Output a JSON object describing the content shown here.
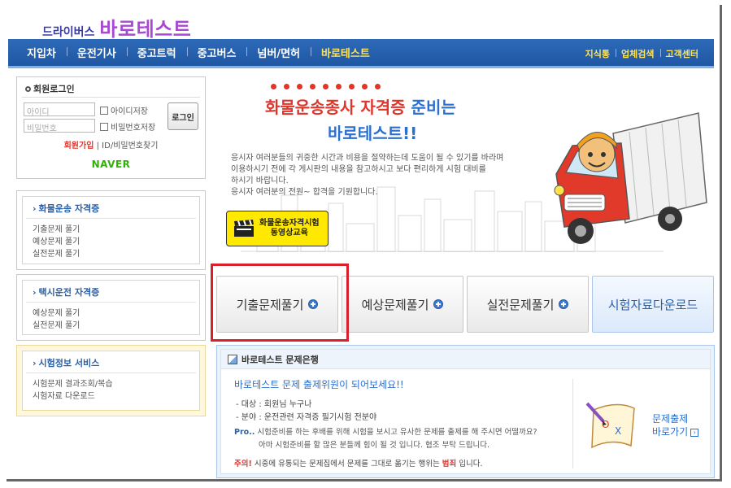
{
  "header": {
    "logo_small": "드라이버스",
    "logo_big": "바로테스트"
  },
  "nav": {
    "items": [
      "지입차",
      "운전기사",
      "중고트럭",
      "중고버스",
      "넘버/면허",
      "바로테스트"
    ],
    "right_items": [
      "지식통",
      "업체검색",
      "고객센터"
    ]
  },
  "login": {
    "title": "회원로그인",
    "id_placeholder": "아이디",
    "pw_placeholder": "비밀번호",
    "save_id": "아이디저장",
    "save_pw": "비밀번호저장",
    "login_button": "로그인",
    "join": "회원가입",
    "find": "ID/비밀번호찾기",
    "naver": "NAVER"
  },
  "sidebar": {
    "truck": {
      "title": "화물운송 자격증",
      "items": [
        "기출문제 풀기",
        "예상문제 풀기",
        "실전문제 풀기"
      ]
    },
    "taxi": {
      "title": "택시운전 자격증",
      "items": [
        "예상문제 풀기",
        "실전문제 풀기"
      ]
    },
    "info": {
      "title": "시험정보 서비스",
      "items": [
        "시험문제 결과조회/복습",
        "시험자료 다운로드"
      ]
    }
  },
  "hero": {
    "title1_red": "화물운송종사 자격증",
    "title1_blue": " 준비는",
    "title2": "바로테스트!!",
    "desc": [
      "응시자 여러분들의 귀중한 시간과 비용을 절약하는데 도움이 될 수 있기를 바라며",
      "이용하시기  전에 각 게시판의 내용을 참고하시고 보다 편리하게 시험 대비를",
      "하시기 바랍니다.",
      "응시자 여러분의 전원~ 합격을 기원합니다."
    ],
    "video_line1": "화물운송자격시험",
    "video_line2": "동영상교육"
  },
  "tabs": {
    "past": "기출문제풀기",
    "expected": "예상문제풀기",
    "practice": "실전문제풀기",
    "download": "시험자료다운로드"
  },
  "qbank": {
    "header": "바로테스트 문제은행",
    "title": "바로테스트 문제 출제위원이 되어보세요!!",
    "target": "- 대상 : 회원님 누구나",
    "field": "- 분야 : 운전관련 자격증 필기시험 전분야",
    "pro_label": "Pro..",
    "pro_text1": " 시험준비를 하는 후배를 위해 시험을 보시고 유사한 문제를 출제를 해 주시면 어떨까요?",
    "pro_text2": "아마 시험준비를 할 많은 분들께 힘이 될 것 입니다. 협조 부탁 드립니다.",
    "warn_label": "주의!",
    "warn_text1": " 시중에 유통되는 문제집에서 문제를 그대로 옮기는 행위는 ",
    "warn_red": "범죄",
    "warn_text2": " 입니다.",
    "go_line1": "문제출제",
    "go_line2": "바로가기"
  }
}
